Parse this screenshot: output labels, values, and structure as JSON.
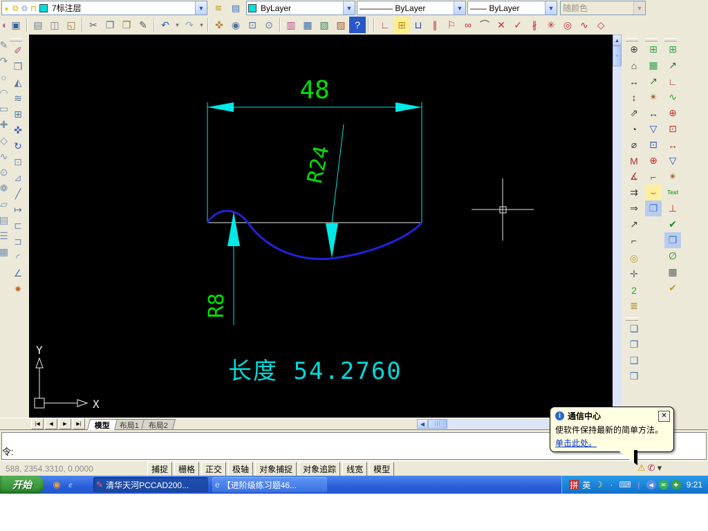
{
  "colors": {
    "dim_cyan": "#00e8e8",
    "text_green": "#00e000",
    "curve_blue": "#2222dd",
    "canvas_white": "#f0f0f0",
    "length_cyan": "#00dada",
    "balloon_bg": "#ffffe1"
  },
  "toolbar_row1": {
    "layer_icons": [
      {
        "name": "layer-visibility-icon",
        "glyph": "●",
        "color": "#f0d000"
      },
      {
        "name": "layer-freeze-icon",
        "glyph": "❂",
        "color": "#e0c030"
      },
      {
        "name": "layer-viewport-freeze-icon",
        "glyph": "❂",
        "color": "#a0a8c0"
      },
      {
        "name": "layer-lock-icon",
        "glyph": "⊓",
        "color": "#c8a000"
      }
    ],
    "layer_swatch": "#00e0e0",
    "layer_value": "7标注层",
    "buttons": [
      {
        "name": "layer-manager-button",
        "glyph": "≋",
        "color": "#b0a000"
      },
      {
        "name": "layer-states-button",
        "glyph": "▤",
        "color": "#4070c0"
      }
    ],
    "color_swatch": "#00e0e0",
    "color_value": "ByLayer",
    "linetype_line": "————",
    "linetype_value": "ByLayer",
    "lineweight_line": "——",
    "lineweight_value": "ByLayer",
    "plotstyle_value": "随颜色"
  },
  "toolbar_row2": {
    "icons": [
      {
        "name": "open-file-icon",
        "glyph": "◖",
        "color": "#c05890",
        "clip": true
      },
      {
        "name": "save-icon",
        "glyph": "▣",
        "color": "#3a5fa0"
      },
      {
        "sep": true
      },
      {
        "name": "print-icon",
        "glyph": "▤",
        "color": "#707a8a"
      },
      {
        "name": "print-preview-icon",
        "glyph": "◫",
        "color": "#707a8a"
      },
      {
        "name": "publish-icon",
        "glyph": "◱",
        "color": "#a07040"
      },
      {
        "sep": true
      },
      {
        "name": "cut-icon",
        "glyph": "✂",
        "color": "#606060"
      },
      {
        "name": "copy-clip-icon",
        "glyph": "❐",
        "color": "#5a6a90"
      },
      {
        "name": "paste-icon",
        "glyph": "❒",
        "color": "#907840"
      },
      {
        "name": "match-properties-icon",
        "glyph": "✎",
        "color": "#555555"
      },
      {
        "sep": true
      },
      {
        "name": "undo-icon",
        "glyph": "↶",
        "color": "#2858c8"
      },
      {
        "name": "undo-dropdown-icon",
        "glyph": "▾",
        "small": true
      },
      {
        "name": "redo-icon",
        "glyph": "↷",
        "color": "#9aa4b4"
      },
      {
        "name": "redo-dropdown-icon",
        "glyph": "▾",
        "small": true
      },
      {
        "sep": true
      },
      {
        "name": "pan-icon",
        "glyph": "✜",
        "color": "#b87828"
      },
      {
        "name": "zoom-realtime-icon",
        "glyph": "◉",
        "color": "#5070a0"
      },
      {
        "name": "zoom-window-icon",
        "glyph": "⊡",
        "color": "#5070a0"
      },
      {
        "name": "zoom-previous-icon",
        "glyph": "⊙",
        "color": "#5070a0"
      },
      {
        "sep": true
      },
      {
        "name": "properties-palette-icon",
        "glyph": "▥",
        "color": "#b84898"
      },
      {
        "name": "designcenter-icon",
        "glyph": "▦",
        "color": "#3868a8"
      },
      {
        "name": "sheetset-manager-icon",
        "glyph": "▧",
        "color": "#388858"
      },
      {
        "name": "markup-manager-icon",
        "glyph": "▨",
        "color": "#a85838"
      },
      {
        "name": "help-icon",
        "glyph": "?",
        "color": "#ffffff",
        "bg": "#2858c8"
      },
      {
        "sep": true
      },
      {
        "sep": true
      },
      {
        "name": "pccad-axis-icon",
        "glyph": "∟",
        "color": "#c03030"
      },
      {
        "name": "pccad-table-icon",
        "glyph": "⊞",
        "color": "#b09020",
        "bg": "#ffee90"
      },
      {
        "name": "pccad-section-icon",
        "glyph": "⊔",
        "color": "#3040b0"
      },
      {
        "name": "pccad-parallel-icon",
        "glyph": "∥",
        "color": "#c03030"
      },
      {
        "name": "pccad-detail-flag-icon",
        "glyph": "⚐",
        "color": "#c03030"
      },
      {
        "name": "pccad-chain-icon",
        "glyph": "∞",
        "color": "#c03030"
      },
      {
        "name": "pccad-hook-icon",
        "glyph": "⌒",
        "color": "#404040"
      },
      {
        "name": "pccad-cross-icon",
        "glyph": "✕",
        "color": "#c03030"
      },
      {
        "name": "pccad-check-icon",
        "glyph": "✓",
        "color": "#c03030"
      },
      {
        "name": "pccad-doubleline-icon",
        "glyph": "∦",
        "color": "#c03030"
      },
      {
        "name": "pccad-star-icon",
        "glyph": "✳",
        "color": "#c03030"
      },
      {
        "name": "pccad-target-icon",
        "glyph": "◎",
        "color": "#c03030"
      },
      {
        "name": "pccad-wave-icon",
        "glyph": "∿",
        "color": "#c03030"
      },
      {
        "name": "pccad-diamond-icon",
        "glyph": "◇",
        "color": "#c03030"
      }
    ]
  },
  "left_toolbar": {
    "clipped_icons": [
      {
        "name": "clipped-draw-icon",
        "glyph": "✎",
        "color": "#7890b0",
        "clip": true
      },
      {
        "name": "clipped-draw-icon",
        "glyph": "↷",
        "color": "#7890b0",
        "clip": true
      },
      {
        "name": "clipped-draw-icon",
        "glyph": "○",
        "color": "#7890b0",
        "clip": true
      },
      {
        "name": "clipped-draw-icon",
        "glyph": "◠",
        "color": "#7890b0",
        "clip": true
      },
      {
        "name": "clipped-draw-icon",
        "glyph": "▭",
        "color": "#7890b0",
        "clip": true
      },
      {
        "name": "clipped-draw-icon",
        "glyph": "✚",
        "color": "#7890b0",
        "clip": true
      },
      {
        "name": "clipped-draw-icon",
        "glyph": "◇",
        "color": "#7890b0",
        "clip": true
      },
      {
        "name": "clipped-draw-icon",
        "glyph": "∿",
        "color": "#7890b0",
        "clip": true
      },
      {
        "name": "clipped-draw-icon",
        "glyph": "⊙",
        "color": "#7890b0",
        "clip": true
      },
      {
        "name": "clipped-draw-icon",
        "glyph": "❁",
        "color": "#7890b0",
        "clip": true
      },
      {
        "name": "clipped-draw-icon",
        "glyph": "▱",
        "color": "#7890b0",
        "clip": true
      },
      {
        "name": "clipped-draw-icon",
        "glyph": "▤",
        "color": "#7890b0",
        "clip": true
      },
      {
        "name": "clipped-draw-icon",
        "glyph": "☰",
        "color": "#7890b0",
        "clip": true
      },
      {
        "name": "clipped-draw-icon",
        "glyph": "▦",
        "color": "#7890b0",
        "clip": true
      }
    ],
    "modify_icons": [
      {
        "name": "erase-icon",
        "glyph": "✐",
        "color": "#b05878"
      },
      {
        "name": "copy-icon",
        "glyph": "❐",
        "color": "#5878a8"
      },
      {
        "name": "mirror-icon",
        "glyph": "◭",
        "color": "#5878a8"
      },
      {
        "name": "offset-icon",
        "glyph": "≋",
        "color": "#5878a8"
      },
      {
        "name": "array-icon",
        "glyph": "⊞",
        "color": "#5878a8"
      },
      {
        "name": "move-icon",
        "glyph": "✜",
        "color": "#3858b8"
      },
      {
        "name": "rotate-icon",
        "glyph": "↻",
        "color": "#3858b8"
      },
      {
        "name": "scale-icon",
        "glyph": "⊡",
        "color": "#7890b8"
      },
      {
        "name": "stretch-icon",
        "glyph": "⊿",
        "color": "#7890b8"
      },
      {
        "name": "trim-icon",
        "glyph": "╱",
        "color": "#5878a8"
      },
      {
        "name": "extend-icon",
        "glyph": "↦",
        "color": "#5878a8"
      },
      {
        "name": "break-point-icon",
        "glyph": "⊏",
        "color": "#7890b8"
      },
      {
        "name": "break-icon",
        "glyph": "⊐",
        "color": "#7890b8"
      },
      {
        "name": "fillet-icon",
        "glyph": "◜",
        "color": "#5878a8"
      },
      {
        "name": "chamfer-icon",
        "glyph": "∠",
        "color": "#5878a8"
      },
      {
        "name": "explode-icon",
        "glyph": "✷",
        "color": "#c06020"
      }
    ]
  },
  "right_toolbar": {
    "col_a": [
      {
        "name": "dim-center-icon",
        "glyph": "⊕",
        "color": "#404040"
      },
      {
        "name": "dim-style-home-icon",
        "glyph": "⌂",
        "color": "#404040"
      },
      {
        "name": "dim-linear-icon",
        "glyph": "↔",
        "color": "#404040"
      },
      {
        "name": "dim-vertical-icon",
        "glyph": "↕",
        "color": "#404040"
      },
      {
        "name": "dim-aligned-icon",
        "glyph": "⇗",
        "color": "#404040"
      },
      {
        "name": "dim-radius-icon",
        "glyph": "◔",
        "color": "#404040"
      },
      {
        "name": "dim-diameter-icon",
        "glyph": "⌀",
        "color": "#404040"
      },
      {
        "name": "dim-edit-icon",
        "glyph": "M",
        "color": "#b03030"
      },
      {
        "name": "dim-angular-icon",
        "glyph": "∡",
        "color": "#b03030"
      },
      {
        "name": "dim-baseline-icon",
        "glyph": "⇉",
        "color": "#404040"
      },
      {
        "name": "dim-continue-icon",
        "glyph": "⇒",
        "color": "#404040"
      },
      {
        "name": "dim-leader-icon",
        "glyph": "↗",
        "color": "#404040"
      },
      {
        "name": "dim-ordinate-icon",
        "glyph": "⌐",
        "color": "#404040"
      }
    ],
    "col_a2": [
      {
        "name": "center-mark-icon",
        "glyph": "◎",
        "color": "#c0a020"
      },
      {
        "name": "dim-pan-icon",
        "glyph": "✛",
        "color": "#707070"
      },
      {
        "name": "partial-dim-icon",
        "glyph": "2",
        "color": "#30a030"
      },
      {
        "name": "dim-style-manager-icon",
        "glyph": "≣",
        "color": "#b08820"
      }
    ],
    "col_a3": [
      {
        "name": "bring-to-front-icon",
        "glyph": "❏",
        "color": "#4878c0"
      },
      {
        "name": "send-to-back-icon",
        "glyph": "❐",
        "color": "#4878c0"
      },
      {
        "name": "bring-above-icon",
        "glyph": "❑",
        "color": "#4878c0"
      },
      {
        "name": "send-under-icon",
        "glyph": "❒",
        "color": "#4878c0"
      }
    ],
    "col_b": [
      {
        "name": "viewport-new-icon",
        "glyph": "⊞",
        "color": "#30a050"
      },
      {
        "name": "viewport-named-icon",
        "glyph": "▦",
        "color": "#30a050"
      },
      {
        "name": "leader-3-icon",
        "glyph": "↗",
        "color": "#307030"
      },
      {
        "name": "wizard-icon",
        "glyph": "✴",
        "color": "#a06030"
      },
      {
        "name": "dim-horizontal-icon",
        "glyph": "↔",
        "color": "#404040"
      },
      {
        "name": "surface-finish-icon",
        "glyph": "▽",
        "color": "#3050c0"
      },
      {
        "name": "datum-box-icon",
        "glyph": "⊡",
        "color": "#3050c0"
      },
      {
        "name": "center-cross-icon",
        "glyph": "⊕",
        "color": "#c03030"
      },
      {
        "name": "corner-line-icon",
        "glyph": "⌐",
        "color": "#606060"
      },
      {
        "name": "weld-symbol-icon",
        "glyph": "⌣",
        "color": "#807020",
        "bg": "#ffefa0"
      },
      {
        "name": "draworder-icon",
        "glyph": "❐",
        "color": "#4878c0",
        "bg": "#b8ccf0"
      }
    ],
    "col_c": [
      {
        "name": "viewport-icon",
        "glyph": "⊞",
        "color": "#30a050"
      },
      {
        "name": "leader-note-icon",
        "glyph": "↗",
        "color": "#307030"
      },
      {
        "name": "axis-icon",
        "glyph": "∟",
        "color": "#c03030"
      },
      {
        "name": "text-wave-icon",
        "glyph": "∿",
        "color": "#30a030"
      },
      {
        "name": "center-cross2-icon",
        "glyph": "⊕",
        "color": "#c03030"
      },
      {
        "name": "dashed-box-icon",
        "glyph": "⊡",
        "color": "#c03030"
      },
      {
        "name": "dim-horizontal2-icon",
        "glyph": "↔",
        "color": "#b03030"
      },
      {
        "name": "surface-finish2-icon",
        "glyph": "▽",
        "color": "#3050c0"
      },
      {
        "name": "wizard2-icon",
        "glyph": "✴",
        "color": "#a06030"
      },
      {
        "name": "text-tool-icon",
        "glyph": "Text",
        "color": "#30a030",
        "text": true
      },
      {
        "name": "section-symbol-icon",
        "glyph": "⊥",
        "color": "#c03030"
      },
      {
        "name": "check-edit-icon",
        "glyph": "✔",
        "color": "#308030"
      },
      {
        "name": "draworder2-icon",
        "glyph": "❐",
        "color": "#4878c0",
        "bg": "#b8ccf0"
      },
      {
        "name": "xclip-icon",
        "glyph": "∅",
        "color": "#308030"
      },
      {
        "name": "table-icon",
        "glyph": "▦",
        "color": "#606060"
      },
      {
        "name": "approve-icon",
        "glyph": "✔",
        "color": "#c0a020"
      }
    ]
  },
  "canvas": {
    "dim_48": "48",
    "dim_r24": "R24",
    "dim_r8": "R8",
    "length_label": "长度  54.2760",
    "ucs_x": "X",
    "ucs_y": "Y"
  },
  "tabs": {
    "nav": [
      {
        "name": "tab-nav-first",
        "glyph": "|◀"
      },
      {
        "name": "tab-nav-prev",
        "glyph": "◀"
      },
      {
        "name": "tab-nav-next",
        "glyph": "▶"
      },
      {
        "name": "tab-nav-last",
        "glyph": "▶|"
      }
    ],
    "items": [
      {
        "name": "tab-model",
        "label": "模型",
        "active": true
      },
      {
        "name": "tab-layout1",
        "label": "布局1"
      },
      {
        "name": "tab-layout2",
        "label": "布局2"
      }
    ]
  },
  "command": {
    "prompt": "命令:"
  },
  "status": {
    "coords": "588, 2354.3310, 0.0000",
    "toggles": [
      {
        "name": "toggle-snap",
        "label": "捕捉"
      },
      {
        "name": "toggle-grid",
        "label": "栅格"
      },
      {
        "name": "toggle-ortho",
        "label": "正交"
      },
      {
        "name": "toggle-polar",
        "label": "极轴"
      },
      {
        "name": "toggle-osnap",
        "label": "对象捕捉"
      },
      {
        "name": "toggle-otrack",
        "label": "对象追踪"
      },
      {
        "name": "toggle-lineweight",
        "label": "线宽"
      },
      {
        "name": "toggle-model",
        "label": "模型"
      }
    ],
    "tray": [
      {
        "name": "status-warning-icon",
        "glyph": "⚠",
        "color": "#d09000"
      },
      {
        "name": "communication-center-icon",
        "glyph": "✆",
        "color": "#b03048"
      },
      {
        "name": "status-menu-arrow-icon",
        "glyph": "▾",
        "color": "#404040"
      }
    ]
  },
  "balloon": {
    "icon": "i",
    "title": "通信中心",
    "message": "使软件保持最新的简单方法。",
    "link": "单击此处。",
    "close": "✕"
  },
  "taskbar": {
    "start": "开始",
    "quick": [
      {
        "name": "quicklaunch-media-icon",
        "glyph": "◉",
        "color": "#f0a030"
      },
      {
        "name": "quicklaunch-ie-icon",
        "glyph": "e",
        "color": "#80c8f8",
        "italic": true
      }
    ],
    "tasks": [
      {
        "name": "task-pccad",
        "icon": "✎",
        "icon_color": "#ff6060",
        "label": "清华天河PCCAD200...",
        "active": true
      },
      {
        "name": "task-browser",
        "icon": "e",
        "icon_color": "#bfe0ff",
        "label": "【进阶级练习题46..."
      }
    ],
    "tray": [
      {
        "name": "ime-mspy-icon",
        "glyph": "拼",
        "color": "#ffffff",
        "bg": "#c03030"
      },
      {
        "name": "ime-lang-icon",
        "glyph": "英",
        "color": "#ffffff"
      },
      {
        "name": "ime-moon-icon",
        "glyph": "☽",
        "color": "#ffe060"
      },
      {
        "name": "ime-dot-icon",
        "glyph": "·",
        "color": "#ffffff"
      },
      {
        "name": "ime-keyboard-icon",
        "glyph": "⌨",
        "color": "#d8e0f0"
      },
      {
        "name": "tray-separator",
        "glyph": "|",
        "color": "#88a8e8"
      },
      {
        "name": "tray-chevron-icon",
        "glyph": "◀",
        "color": "#ffffff",
        "bg": "#5a8ee8",
        "round": true
      },
      {
        "name": "tray-messenger-icon",
        "glyph": "✉",
        "color": "#ffffff",
        "bg": "#38b058",
        "round": true
      },
      {
        "name": "tray-update-icon",
        "glyph": "✚",
        "color": "#ffffff",
        "bg": "#38a048",
        "round": true
      }
    ],
    "time": "9:21"
  }
}
